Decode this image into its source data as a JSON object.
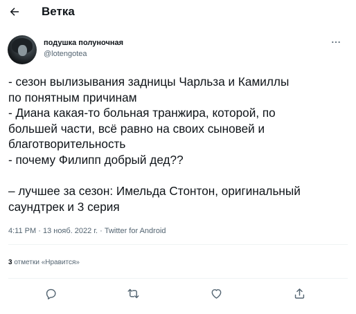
{
  "header": {
    "back_icon": "arrow-left-icon",
    "title": "Ветка"
  },
  "tweet": {
    "author": {
      "display_name": "подушка полуночная",
      "handle": "@lotengotea"
    },
    "more_icon": "more-horizontal-icon",
    "text": "- сезон вылизывания задницы Чарльза и Камиллы\nпо понятным причинам\n- Диана какая-то больная транжира, которой, по\nбольшей части, всё равно на своих сыновей и\nблаготворительность\n- почему Филипп добрый дед??\n\n– лучшее за сезон: Имельда Стонтон, оригинальный\nсаундтрек и 3 серия",
    "meta": {
      "time": "4:11 PM",
      "separator": "·",
      "date": "13 нояб. 2022 г.",
      "source": "Twitter for Android"
    },
    "likes": {
      "count": "3",
      "label": "отметки «Нравится»"
    },
    "actions": [
      {
        "icon": "reply-icon"
      },
      {
        "icon": "retweet-icon"
      },
      {
        "icon": "like-icon"
      },
      {
        "icon": "share-icon"
      }
    ]
  },
  "colors": {
    "text": "#0f1419",
    "secondary": "#536471",
    "divider": "#eff3f4"
  }
}
